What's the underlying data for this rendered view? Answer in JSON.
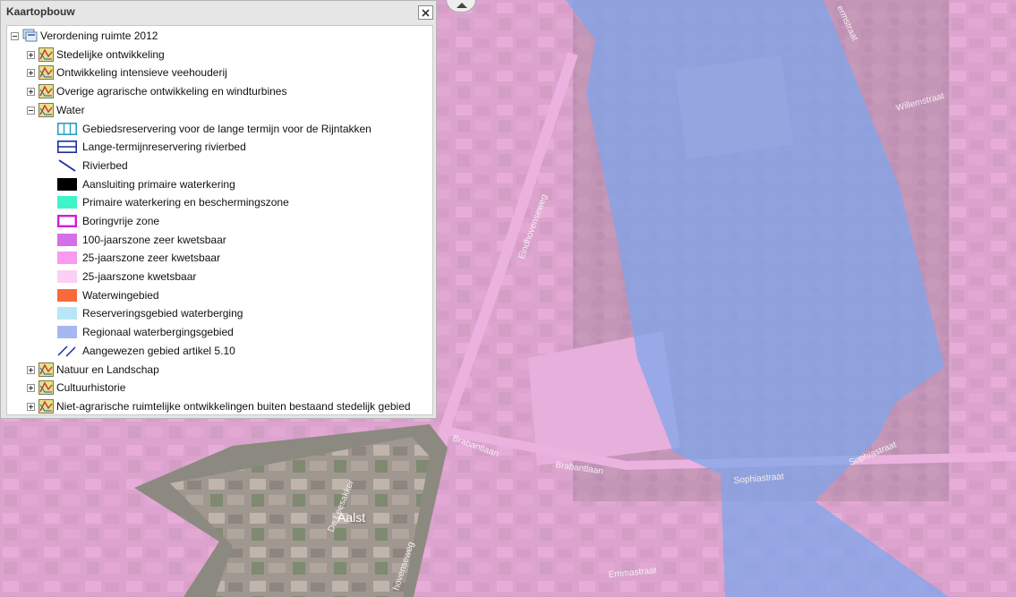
{
  "panel": {
    "title": "Kaartopbouw",
    "root_label": "Verordening ruimte 2012",
    "groups_before": [
      {
        "label": "Stedelijke ontwikkeling"
      },
      {
        "label": "Ontwikkeling intensieve veehouderij"
      },
      {
        "label": "Overige agrarische ontwikkeling en windturbines"
      }
    ],
    "water_label": "Water",
    "water_items": [
      {
        "label": "Gebiedsreservering voor de lange termijn voor de Rijntakken",
        "swatch": "grid-cyan",
        "color": "#2aa0c8"
      },
      {
        "label": "Lange-termijnreservering rivierbed",
        "swatch": "double-blue",
        "color": "#1b2f9e"
      },
      {
        "label": "Rivierbed",
        "swatch": "diag-line",
        "color": "#1b2f9e"
      },
      {
        "label": "Aansluiting primaire waterkering",
        "swatch": "fill",
        "color": "#000000"
      },
      {
        "label": "Primaire waterkering en beschermingszone",
        "swatch": "fill",
        "color": "#3ff5c8"
      },
      {
        "label": "Boringvrije zone",
        "swatch": "outline",
        "color": "#d21fd2"
      },
      {
        "label": "100-jaarszone zeer kwetsbaar",
        "swatch": "fill",
        "color": "#d56ee8"
      },
      {
        "label": "25-jaarszone zeer kwetsbaar",
        "swatch": "fill",
        "color": "#f79af0"
      },
      {
        "label": "25-jaarszone kwetsbaar",
        "swatch": "fill",
        "color": "#fbd0f4"
      },
      {
        "label": "Waterwingebied",
        "swatch": "fill",
        "color": "#f86a3a"
      },
      {
        "label": "Reserveringsgebied waterberging",
        "swatch": "fill",
        "color": "#b6e6f8"
      },
      {
        "label": "Regionaal waterbergingsgebied",
        "swatch": "fill",
        "color": "#a4b8f2"
      },
      {
        "label": "Aangewezen gebied artikel 5.10",
        "swatch": "double-diag",
        "color": "#1b2f9e"
      }
    ],
    "groups_after": [
      {
        "label": "Natuur en Landschap"
      },
      {
        "label": "Cultuurhistorie"
      },
      {
        "label": "Niet-agrarische ruimtelijke ontwikkelingen buiten bestaand stedelijk gebied"
      }
    ]
  },
  "map": {
    "labels": {
      "aalst": "Aalst",
      "eindhovenseweg_1": "Eindhovenseweg",
      "eindhovenseweg_2": "hovenseweg",
      "brabantlaan_1": "Brabantlaan",
      "brabantlaan_2": "Brabantlaan",
      "sophiastraat_1": "Sophiastraat",
      "sophiastraat_2": "Sophiastraat",
      "willemstraat": "Willemstraat",
      "de_leesakker": "De Leesakker",
      "emmastraat": "Emmastraat",
      "ermstraat": "ermstraat"
    },
    "colors": {
      "pink_zone": "#f2a6e6",
      "blue_zone": "#7fa6ea",
      "aerial_base": "#9a8f88"
    }
  }
}
